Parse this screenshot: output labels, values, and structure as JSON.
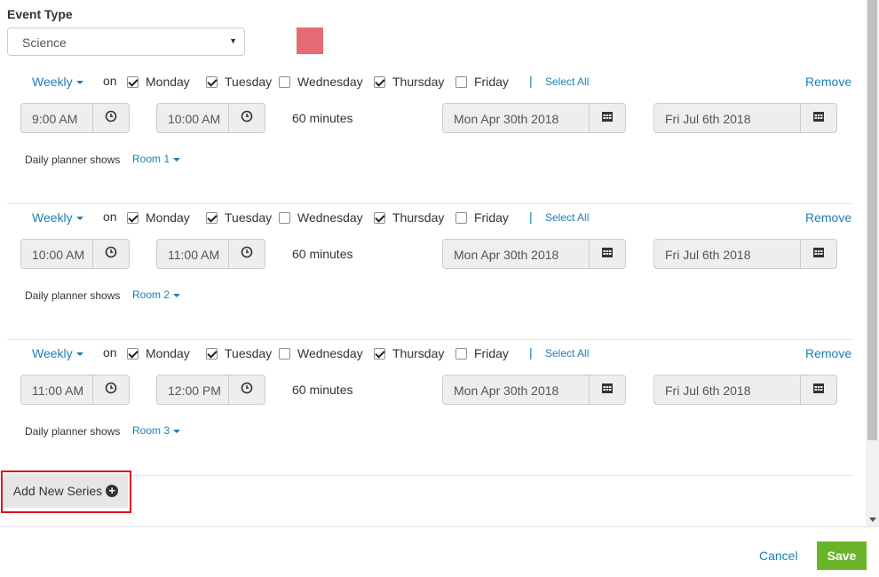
{
  "event_type": {
    "label": "Event Type",
    "selected": "Science",
    "color": "#e66b74"
  },
  "series": [
    {
      "frequency": "Weekly",
      "on_label": "on",
      "days": [
        {
          "label": "Monday",
          "checked": true
        },
        {
          "label": "Tuesday",
          "checked": true
        },
        {
          "label": "Wednesday",
          "checked": false
        },
        {
          "label": "Thursday",
          "checked": true
        },
        {
          "label": "Friday",
          "checked": false
        }
      ],
      "pipe": "|",
      "select_all": "Select All",
      "remove": "Remove",
      "start_time": "9:00 AM",
      "end_time": "10:00 AM",
      "duration": "60 minutes",
      "start_date": "Mon Apr 30th 2018",
      "end_date": "Fri Jul 6th 2018",
      "planner_label": "Daily planner shows",
      "room": "Room 1"
    },
    {
      "frequency": "Weekly",
      "on_label": "on",
      "days": [
        {
          "label": "Monday",
          "checked": true
        },
        {
          "label": "Tuesday",
          "checked": true
        },
        {
          "label": "Wednesday",
          "checked": false
        },
        {
          "label": "Thursday",
          "checked": true
        },
        {
          "label": "Friday",
          "checked": false
        }
      ],
      "pipe": "|",
      "select_all": "Select All",
      "remove": "Remove",
      "start_time": "10:00 AM",
      "end_time": "11:00 AM",
      "duration": "60 minutes",
      "start_date": "Mon Apr 30th 2018",
      "end_date": "Fri Jul 6th 2018",
      "planner_label": "Daily planner shows",
      "room": "Room 2"
    },
    {
      "frequency": "Weekly",
      "on_label": "on",
      "days": [
        {
          "label": "Monday",
          "checked": true
        },
        {
          "label": "Tuesday",
          "checked": true
        },
        {
          "label": "Wednesday",
          "checked": false
        },
        {
          "label": "Thursday",
          "checked": true
        },
        {
          "label": "Friday",
          "checked": false
        }
      ],
      "pipe": "|",
      "select_all": "Select All",
      "remove": "Remove",
      "start_time": "11:00 AM",
      "end_time": "12:00 PM",
      "duration": "60 minutes",
      "start_date": "Mon Apr 30th 2018",
      "end_date": "Fri Jul 6th 2018",
      "planner_label": "Daily planner shows",
      "room": "Room 3"
    }
  ],
  "add_series": {
    "label": "Add New Series",
    "icon": "plus-circle-icon"
  },
  "footer": {
    "cancel": "Cancel",
    "save": "Save"
  },
  "colors": {
    "link": "#1a7fb5",
    "save": "#6ab42a",
    "highlight": "#e0101a"
  }
}
